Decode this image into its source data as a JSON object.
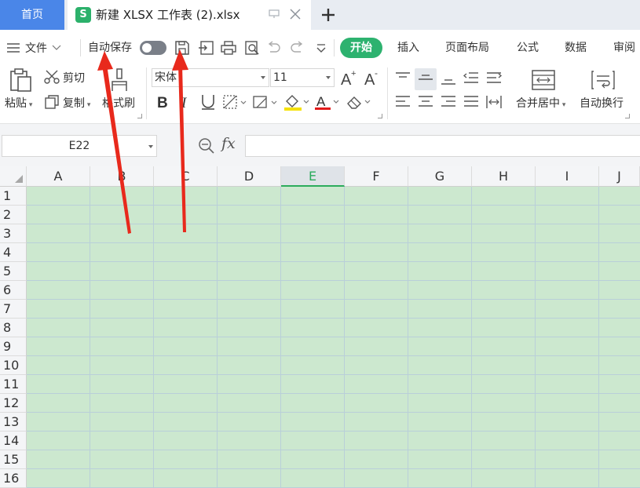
{
  "tabs": {
    "home_label": "首页",
    "file_logo": "S",
    "file_name": "新建 XLSX 工作表 (2).xlsx"
  },
  "menu": {
    "file_label": "文件",
    "autosave_label": "自动保存",
    "autosave_on": false,
    "items": [
      "开始",
      "插入",
      "页面布局",
      "公式",
      "数据",
      "审阅"
    ],
    "active_item": "开始"
  },
  "ribbon": {
    "cut_label": "剪切",
    "paste_label": "粘贴",
    "copy_label": "复制",
    "format_painter_label": "格式刷",
    "font_name": "宋体",
    "font_size": "11",
    "merge_label": "合并居中",
    "wrap_label": "自动换行"
  },
  "formula_bar": {
    "cell_ref": "E22",
    "fx_label": "fx",
    "formula_value": ""
  },
  "grid": {
    "columns": [
      "A",
      "B",
      "C",
      "D",
      "E",
      "F",
      "G",
      "H",
      "I",
      "J"
    ],
    "active_column": "E",
    "rows": [
      "1",
      "2",
      "3",
      "4",
      "5",
      "6",
      "7",
      "8",
      "9",
      "10",
      "11",
      "12",
      "13",
      "14",
      "15",
      "16"
    ],
    "cell_fill": "#cce8cf"
  },
  "colors": {
    "accent_green": "#2db26f",
    "home_tab_blue": "#4a86e8",
    "annotation_red": "#e8291c"
  }
}
